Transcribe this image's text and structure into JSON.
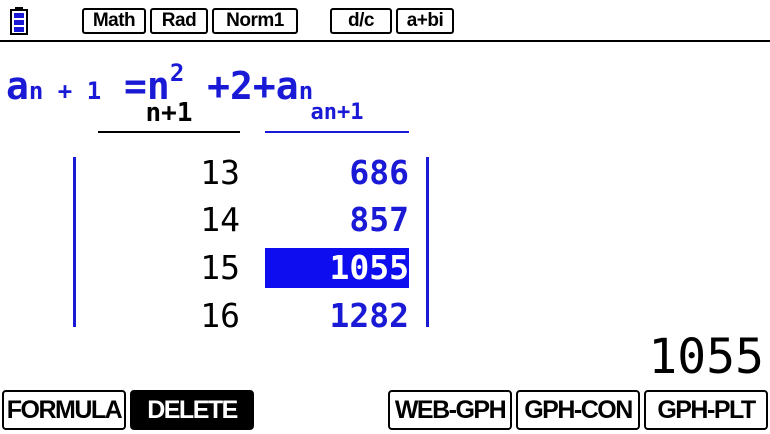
{
  "status_bar": {
    "battery_icon": "battery-icon",
    "modes": [
      "Math",
      "Rad",
      "Norm1",
      "d/c",
      "a+bi"
    ]
  },
  "formula": {
    "lhs_base": "a",
    "lhs_sub": "n + 1",
    "eq": "=",
    "rhs_n": "n",
    "rhs_exp": "2",
    "rhs_plus": "+2+",
    "rhs_a": "a",
    "rhs_sub": "n"
  },
  "table": {
    "headers": [
      "n+1",
      "an+1"
    ],
    "rows": [
      {
        "n": "13",
        "a": "686"
      },
      {
        "n": "14",
        "a": "857"
      },
      {
        "n": "15",
        "a": "1055"
      },
      {
        "n": "16",
        "a": "1282"
      }
    ],
    "selected_row": 2
  },
  "selected_value": "1055",
  "function_keys": [
    {
      "label": "FORMULA",
      "inverted": false
    },
    {
      "label": "DELETE",
      "inverted": true
    },
    {
      "label": "",
      "inverted": false
    },
    {
      "label": "WEB-GPH",
      "inverted": false
    },
    {
      "label": "GPH-CON",
      "inverted": false
    },
    {
      "label": "GPH-PLT",
      "inverted": false
    }
  ],
  "colors": {
    "accent_blue": "#1a1ad6",
    "selection_blue": "#0d0df0",
    "text_black": "#000000"
  }
}
